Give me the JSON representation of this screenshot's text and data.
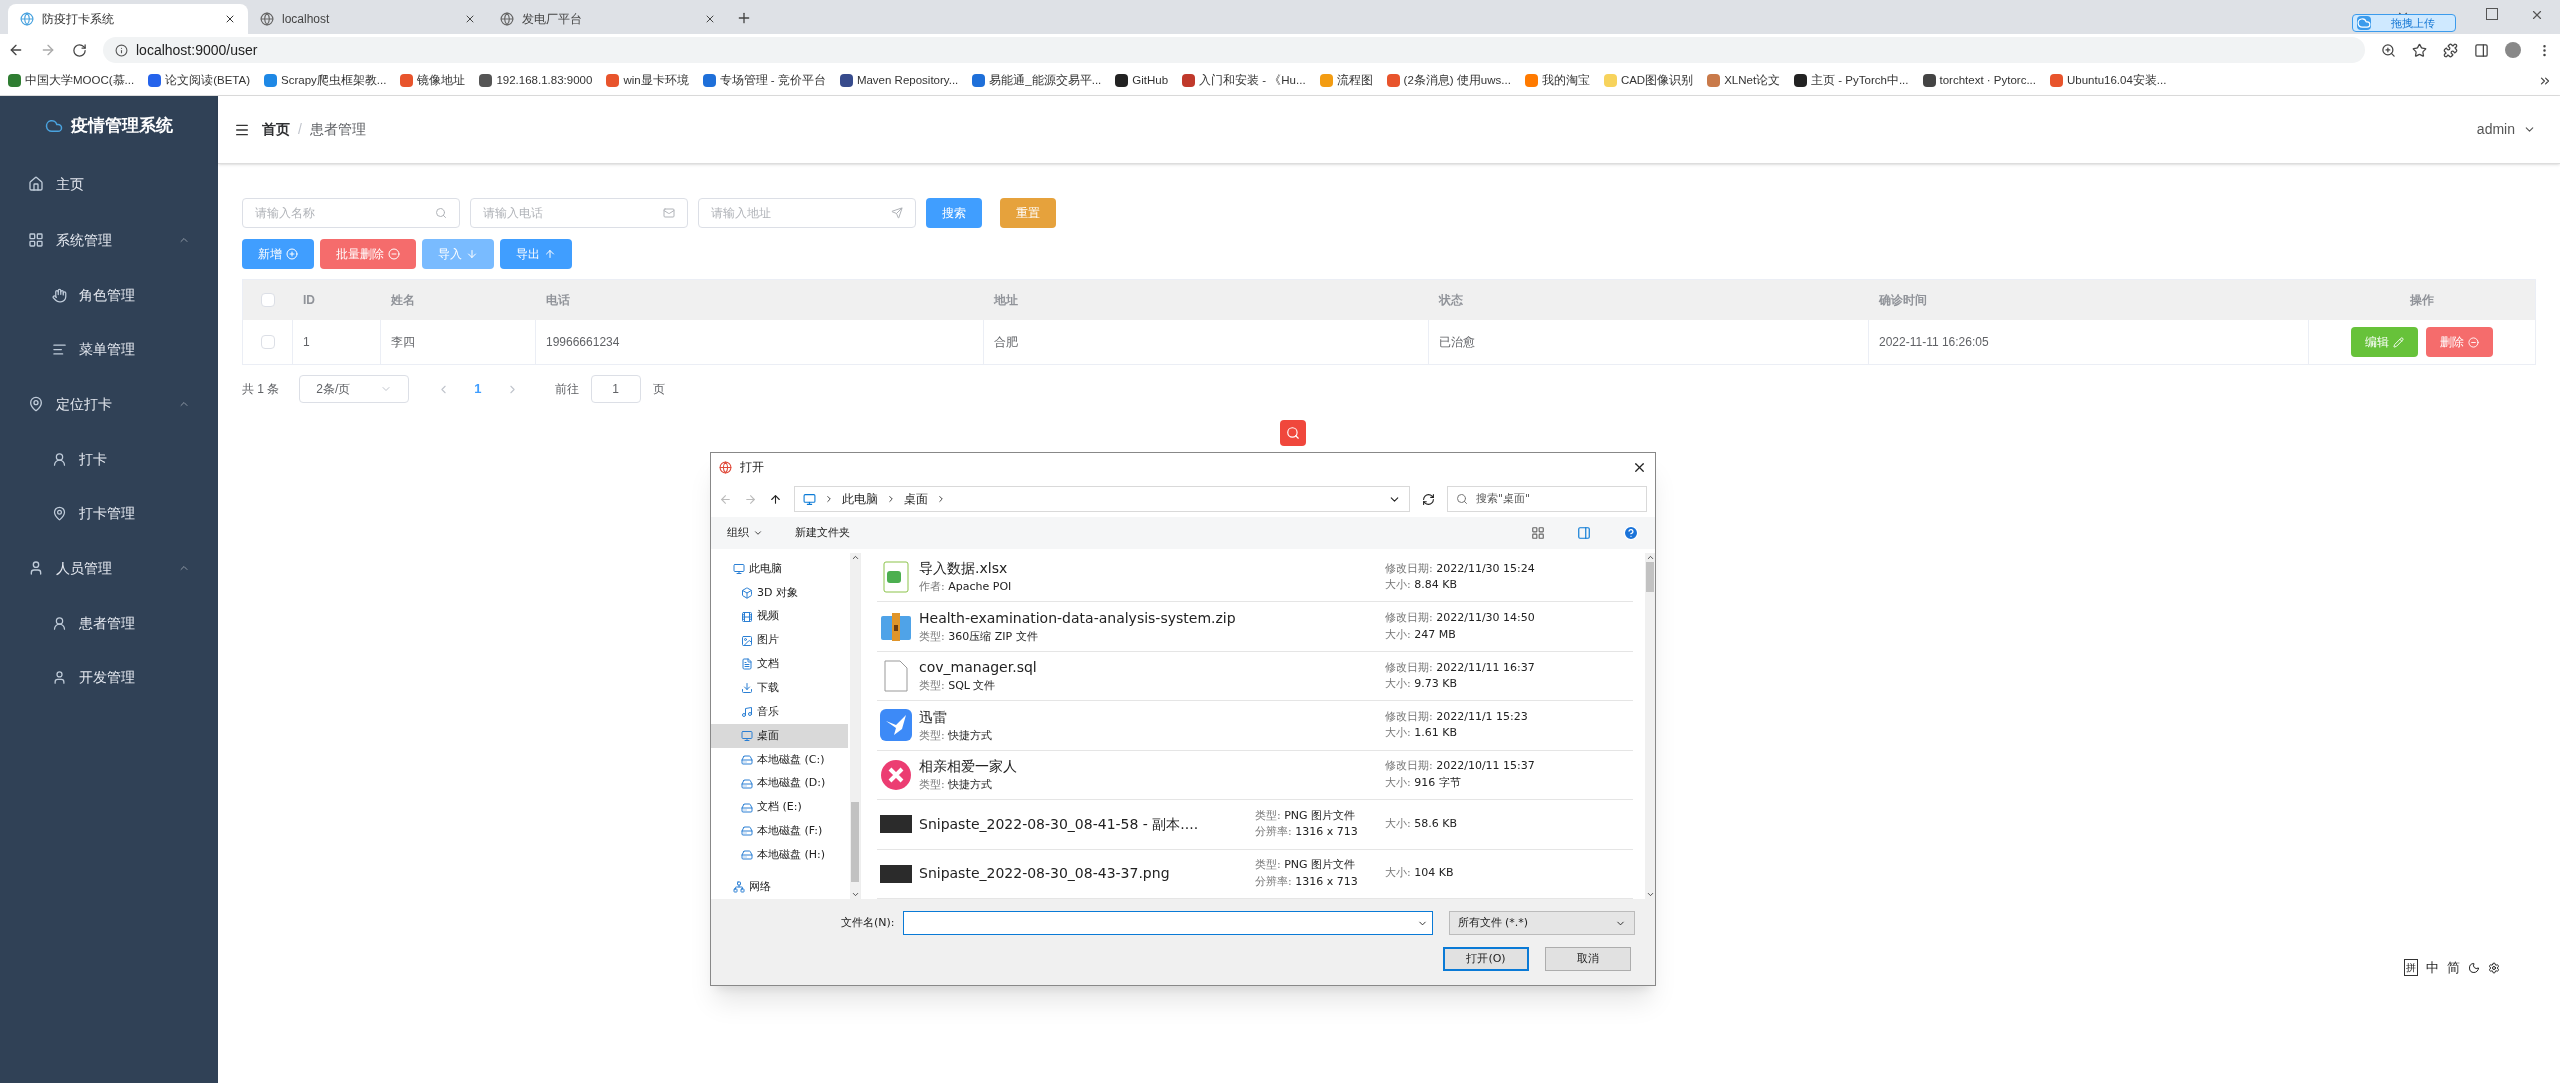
{
  "browser": {
    "tabs": [
      {
        "title": "防疫打卡系统",
        "selected": true
      },
      {
        "title": "localhost",
        "selected": false
      },
      {
        "title": "发电厂平台",
        "selected": false
      }
    ],
    "address": "localhost:9000/user",
    "upload_badge": "拖拽上传",
    "bookmarks": [
      "中国大学MOOC(慕...",
      "论文阅读(BETA)",
      "Scrapy爬虫框架教...",
      "镜像地址",
      "192.168.1.83:9000",
      "win显卡环境",
      "专场管理 - 竞价平台",
      "Maven Repository...",
      "易能通_能源交易平...",
      "GitHub",
      "入门和安装 - 《Hu...",
      "流程图",
      "(2条消息) 使用uws...",
      "我的淘宝",
      "CAD图像识别",
      "XLNet论文",
      "主页 - PyTorch中...",
      "torchtext · Pytorc...",
      "Ubuntu16.04安装..."
    ]
  },
  "sidebar": {
    "title": "疫情管理系统",
    "items": [
      {
        "label": "主页"
      },
      {
        "label": "系统管理",
        "expanded": true,
        "children": [
          {
            "label": "角色管理"
          },
          {
            "label": "菜单管理"
          }
        ]
      },
      {
        "label": "定位打卡",
        "expanded": true,
        "children": [
          {
            "label": "打卡"
          },
          {
            "label": "打卡管理"
          }
        ]
      },
      {
        "label": "人员管理",
        "expanded": true,
        "children": [
          {
            "label": "患者管理"
          },
          {
            "label": "开发管理"
          }
        ]
      }
    ]
  },
  "header": {
    "breadcrumb": [
      "首页",
      "患者管理"
    ],
    "breadcrumb_separator": "/",
    "user": "admin"
  },
  "search": {
    "fields": [
      {
        "placeholder": "请输入名称"
      },
      {
        "placeholder": "请输入电话"
      },
      {
        "placeholder": "请输入地址"
      }
    ],
    "search_button": "搜索",
    "reset_button": "重置"
  },
  "actions": [
    {
      "label": "新增",
      "kind": "primary"
    },
    {
      "label": "批量删除",
      "kind": "danger"
    },
    {
      "label": "导入",
      "kind": "light"
    },
    {
      "label": "导出",
      "kind": "primary"
    }
  ],
  "table": {
    "header_checked": false,
    "columns": [
      "ID",
      "姓名",
      "电话",
      "地址",
      "状态",
      "确诊时间",
      "操作"
    ],
    "rows": [
      {
        "checked": false,
        "cells": [
          "1",
          "李四",
          "19966661234",
          "合肥",
          "已治愈",
          "2022-11-11 16:26:05"
        ],
        "edit": "编辑",
        "delete": "删除"
      }
    ]
  },
  "pagination": {
    "total": "共 1 条",
    "page_size": "2条/页",
    "pages": [
      {
        "label": "1",
        "selected": true
      }
    ],
    "goto": "前往",
    "goto_value": "1",
    "goto_suffix": "页"
  },
  "dialog": {
    "title": "打开",
    "path": [
      "此电脑",
      "桌面"
    ],
    "search_placeholder": "搜索\"桌面\"",
    "toolbar": [
      "组织",
      "新建文件夹"
    ],
    "nav": [
      {
        "label": "此电脑",
        "selected": false,
        "children": [
          {
            "label": "3D 对象",
            "selected": false
          },
          {
            "label": "视频",
            "selected": false
          },
          {
            "label": "图片",
            "selected": false
          },
          {
            "label": "文档",
            "selected": false
          },
          {
            "label": "下载",
            "selected": false
          },
          {
            "label": "音乐",
            "selected": false
          },
          {
            "label": "桌面",
            "selected": true
          },
          {
            "label": "本地磁盘 (C:)",
            "selected": false
          },
          {
            "label": "本地磁盘 (D:)",
            "selected": false
          },
          {
            "label": "文档 (E:)",
            "selected": false
          },
          {
            "label": "本地磁盘 (F:)",
            "selected": false
          },
          {
            "label": "本地磁盘 (H:)",
            "selected": false
          }
        ]
      },
      {
        "label": "网络",
        "selected": false
      }
    ],
    "files": [
      {
        "kind": "xlsx",
        "name": "导入数据.xlsx",
        "sub": {
          "label": "作者:",
          "value": "Apache POI"
        },
        "right": [
          {
            "label": "修改日期:",
            "value": "2022/11/30 15:24"
          },
          {
            "label": "大小:",
            "value": "8.84 KB"
          }
        ]
      },
      {
        "kind": "zip",
        "name": "Health-examination-data-analysis-system.zip",
        "sub": {
          "label": "类型:",
          "value": "360压缩 ZIP 文件"
        },
        "right": [
          {
            "label": "修改日期:",
            "value": "2022/11/30 14:50"
          },
          {
            "label": "大小:",
            "value": "247 MB"
          }
        ]
      },
      {
        "kind": "sql",
        "name": "cov_manager.sql",
        "sub": {
          "label": "类型:",
          "value": "SQL 文件"
        },
        "right": [
          {
            "label": "修改日期:",
            "value": "2022/11/11 16:37"
          },
          {
            "label": "大小:",
            "value": "9.73 KB"
          }
        ]
      },
      {
        "kind": "bird",
        "name": "迅雷",
        "sub": {
          "label": "类型:",
          "value": "快捷方式"
        },
        "right": [
          {
            "label": "修改日期:",
            "value": "2022/11/1 15:23"
          },
          {
            "label": "大小:",
            "value": "1.61 KB"
          }
        ]
      },
      {
        "kind": "pink",
        "name": "相亲相爱一家人",
        "sub": {
          "label": "类型:",
          "value": "快捷方式"
        },
        "right": [
          {
            "label": "修改日期:",
            "value": "2022/10/11 15:37"
          },
          {
            "label": "大小:",
            "value": "916 字节"
          }
        ]
      },
      {
        "kind": "image",
        "name": "Snipaste_2022-08-30_08-41-58 - 副本....",
        "middle": [
          {
            "label": "类型:",
            "value": "PNG 图片文件"
          },
          {
            "label": "分辨率:",
            "value": "1316 x 713"
          }
        ],
        "right": [
          {
            "label": "大小:",
            "value": "58.6 KB"
          }
        ]
      },
      {
        "kind": "image",
        "name": "Snipaste_2022-08-30_08-43-37.png",
        "middle": [
          {
            "label": "类型:",
            "value": "PNG 图片文件"
          },
          {
            "label": "分辨率:",
            "value": "1316 x 713"
          }
        ],
        "right": [
          {
            "label": "大小:",
            "value": "104 KB"
          }
        ]
      }
    ],
    "filename_label": "文件名(N):",
    "filter": "所有文件 (*.*)",
    "open_button": "打开(O)",
    "cancel_button": "取消"
  },
  "ime": [
    "拼",
    "中",
    "简"
  ]
}
